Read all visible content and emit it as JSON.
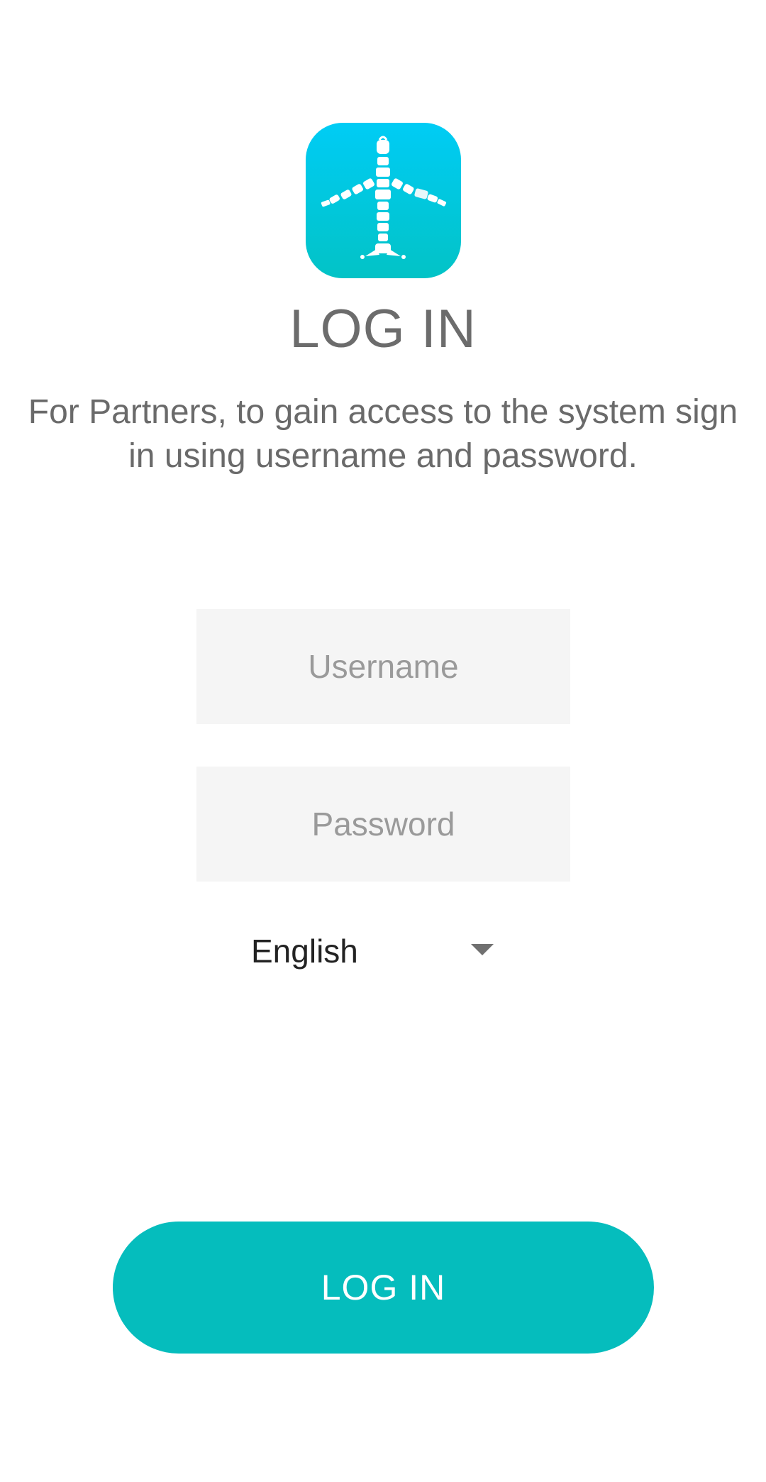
{
  "app": {
    "logo_icon": "airplane-luggage-icon",
    "logo_gradient": [
      "#00ccf5",
      "#02c3c6"
    ]
  },
  "header": {
    "title": "LOG IN",
    "description": "For Partners, to gain access to the system sign in using username and password."
  },
  "form": {
    "username": {
      "value": "",
      "placeholder": "Username"
    },
    "password": {
      "value": "",
      "placeholder": "Password"
    },
    "language": {
      "selected": "English",
      "icon": "dropdown-arrow-icon"
    },
    "submit_label": "LOG IN"
  },
  "colors": {
    "accent": "#05bdbd",
    "text_gray": "#6c6c6c",
    "field_bg": "#f5f5f5"
  }
}
